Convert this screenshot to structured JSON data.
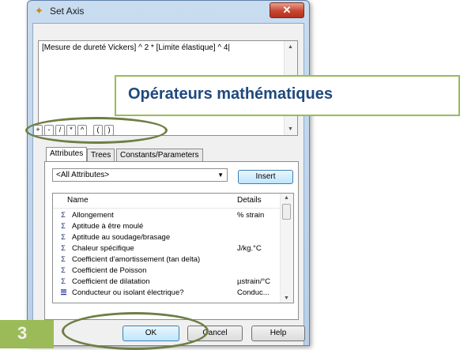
{
  "window": {
    "title": "Set Axis",
    "close_glyph": "✕",
    "icon": "axis-icon"
  },
  "formula": {
    "text": "[Mesure de dureté Vickers] ^ 2 * [Limite élastique] ^ 4|"
  },
  "operators": [
    "+",
    "-",
    "/",
    "*",
    "^",
    "(",
    ")"
  ],
  "tabs": [
    {
      "label": "Attributes",
      "active": true
    },
    {
      "label": "Trees",
      "active": false
    },
    {
      "label": "Constants/Parameters",
      "active": false
    }
  ],
  "attribute_filter": {
    "selected": "<All Attributes>"
  },
  "insert_label": "Insert",
  "list": {
    "columns": [
      "Name",
      "Details"
    ],
    "rows": [
      {
        "icon": "sigma-icon",
        "name": "Allongement",
        "details": "% strain"
      },
      {
        "icon": "sigma-icon",
        "name": "Aptitude à être moulé",
        "details": ""
      },
      {
        "icon": "sigma-icon",
        "name": "Aptitude au soudage/brasage",
        "details": ""
      },
      {
        "icon": "sigma-icon",
        "name": "Chaleur spécifique",
        "details": "J/kg.°C"
      },
      {
        "icon": "sigma-icon",
        "name": "Coefficient d'amortissement (tan delta)",
        "details": ""
      },
      {
        "icon": "sigma-icon",
        "name": "Coefficient de Poisson",
        "details": ""
      },
      {
        "icon": "sigma-icon",
        "name": "Coefficient de dilatation",
        "details": "µstrain/°C"
      },
      {
        "icon": "bars-icon",
        "name": "Conducteur ou isolant électrique?",
        "details": "Conduc..."
      }
    ]
  },
  "buttons": {
    "ok": "OK",
    "cancel": "Cancel",
    "help": "Help"
  },
  "callout": {
    "text": "Opérateurs mathématiques"
  },
  "step_badge": "3",
  "colors": {
    "callout_border": "#9bbb59",
    "callout_text": "#1f497d",
    "badge_fill": "#9bbb59",
    "oval_stroke": "#6e7e45"
  }
}
